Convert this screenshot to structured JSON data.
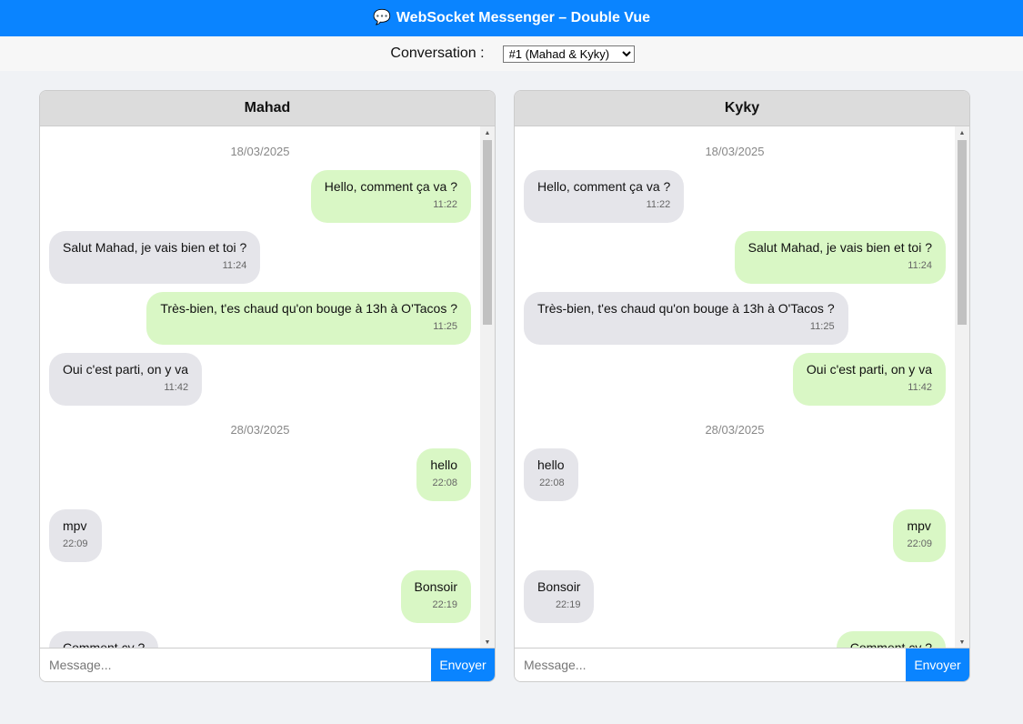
{
  "app": {
    "icon": "speech-bubble-icon",
    "title": "WebSocket Messenger – Double Vue",
    "accent": "#0a84ff"
  },
  "conversation": {
    "label": "Conversation :",
    "selected": "#1 (Mahad & Kyky)"
  },
  "panels": [
    {
      "name": "Mahad",
      "placeholder": "Message...",
      "send_label": "Envoyer",
      "items": [
        {
          "kind": "date",
          "text": "18/03/2025"
        },
        {
          "kind": "msg",
          "side": "own",
          "text": "Hello, comment ça va ?",
          "time": "11:22"
        },
        {
          "kind": "msg",
          "side": "other",
          "text": "Salut Mahad, je vais bien et toi ?",
          "time": "11:24"
        },
        {
          "kind": "msg",
          "side": "own",
          "text": "Très-bien, t'es chaud qu'on bouge à 13h à O'Tacos ?",
          "time": "11:25"
        },
        {
          "kind": "msg",
          "side": "other",
          "text": "Oui c'est parti, on y va",
          "time": "11:42"
        },
        {
          "kind": "date",
          "text": "28/03/2025"
        },
        {
          "kind": "msg",
          "side": "own",
          "text": "hello",
          "time": "22:08"
        },
        {
          "kind": "msg",
          "side": "other",
          "text": "mpv",
          "time": "22:09"
        },
        {
          "kind": "msg",
          "side": "own",
          "text": "Bonsoir",
          "time": "22:19"
        },
        {
          "kind": "msg",
          "side": "other",
          "text": "Comment cv ?",
          "time": ""
        }
      ]
    },
    {
      "name": "Kyky",
      "placeholder": "Message...",
      "send_label": "Envoyer",
      "items": [
        {
          "kind": "date",
          "text": "18/03/2025"
        },
        {
          "kind": "msg",
          "side": "other",
          "text": "Hello, comment ça va ?",
          "time": "11:22"
        },
        {
          "kind": "msg",
          "side": "own",
          "text": "Salut Mahad, je vais bien et toi ?",
          "time": "11:24"
        },
        {
          "kind": "msg",
          "side": "other",
          "text": "Très-bien, t'es chaud qu'on bouge à 13h à O'Tacos ?",
          "time": "11:25"
        },
        {
          "kind": "msg",
          "side": "own",
          "text": "Oui c'est parti, on y va",
          "time": "11:42"
        },
        {
          "kind": "date",
          "text": "28/03/2025"
        },
        {
          "kind": "msg",
          "side": "other",
          "text": "hello",
          "time": "22:08"
        },
        {
          "kind": "msg",
          "side": "own",
          "text": "mpv",
          "time": "22:09"
        },
        {
          "kind": "msg",
          "side": "other",
          "text": "Bonsoir",
          "time": "22:19"
        },
        {
          "kind": "msg",
          "side": "own",
          "text": "Comment cv ?",
          "time": ""
        }
      ]
    }
  ]
}
